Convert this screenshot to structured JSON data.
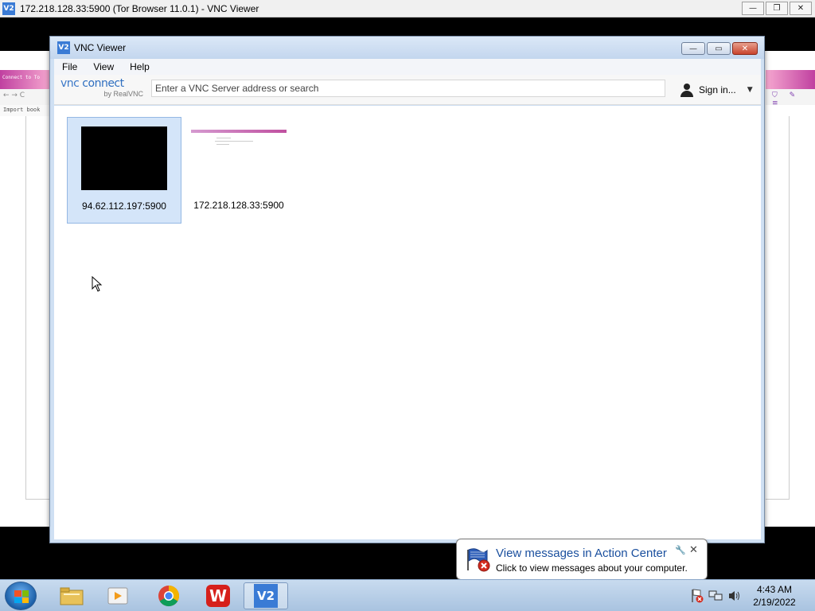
{
  "outer_window": {
    "title": "172.218.128.33:5900 (Tor Browser 11.0.1) - VNC Viewer",
    "logo_text": "V2",
    "buttons": {
      "minimize": "—",
      "restore": "❐",
      "close": "✕"
    }
  },
  "remote_browser": {
    "tab_text": "Connect to To",
    "nav_text": "← → C",
    "bookmark_text": "Import book",
    "right_icons": "⛉ ✎ ≡"
  },
  "vnc_viewer": {
    "title": "VNC Viewer",
    "logo_text": "V2",
    "buttons": {
      "minimize": "—",
      "maximize": "▭",
      "close": "✕"
    },
    "menu": [
      "File",
      "View",
      "Help"
    ],
    "brand": {
      "line1_a": "vnc",
      "line1_b": " connect",
      "line2": "by RealVNC"
    },
    "search": {
      "placeholder": "Enter a VNC Server address or search",
      "value": ""
    },
    "signin": {
      "label": "Sign in...",
      "caret": "▼"
    },
    "connections": [
      {
        "address": "94.62.112.197:5900",
        "thumbnail": "black",
        "selected": true
      },
      {
        "address": "172.218.128.33:5900",
        "thumbnail": "preview",
        "selected": false
      }
    ]
  },
  "notification": {
    "title": "View messages in Action Center",
    "text": "Click to view messages about your computer.",
    "close": "✕",
    "wrench": "🔧"
  },
  "taskbar": {
    "items": [
      "windows-explorer",
      "media-player",
      "chrome",
      "wps-office",
      "vnc-viewer"
    ],
    "active_item": "vnc-viewer",
    "vnc_text": "V2",
    "wps_text": "W",
    "clock": {
      "time": "4:43 AM",
      "date": "2/19/2022"
    }
  },
  "colors": {
    "accent": "#3a7bd5",
    "selected_tile": "#d4e5f9",
    "notification_title": "#1a4f9e"
  }
}
